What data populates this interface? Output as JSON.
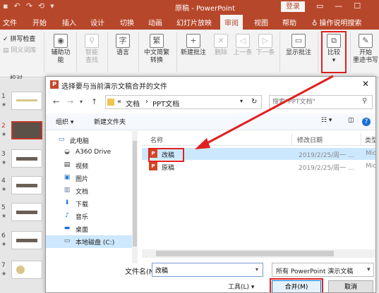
{
  "titlebar": {
    "quick_access": [
      "↶",
      "↷",
      "⟲",
      "▾"
    ],
    "doc_name": "原稿",
    "separator": "-",
    "app_name": "PowerPoint",
    "login": "登录",
    "controls": [
      "▭",
      "—",
      "☐"
    ]
  },
  "tabs": [
    "文件",
    "开始",
    "插入",
    "设计",
    "切换",
    "动画",
    "幻灯片放映",
    "审阅",
    "视图",
    "帮助",
    "操作说明搜索"
  ],
  "active_tab": "审阅",
  "ribbon": {
    "spelling": "拼写检查",
    "thesaurus": "同义词库",
    "proofing_group": "校对",
    "accessibility": [
      "辅助功",
      "能"
    ],
    "smart_lookup": [
      "智能",
      "查找"
    ],
    "language": "语言",
    "chinese_conversion": [
      "中文简繁",
      "转换"
    ],
    "new_comment": "新建批注",
    "delete": "删除",
    "previous": "上一条",
    "next": "下一条",
    "show_comments": "显示批注",
    "compare": "比较",
    "ink": [
      "开始",
      "墨迹书写"
    ]
  },
  "slides": [
    {
      "num": "1",
      "star": "★"
    },
    {
      "num": "2",
      "star": "★"
    },
    {
      "num": "3",
      "star": "★"
    },
    {
      "num": "4",
      "star": "★"
    },
    {
      "num": "5",
      "star": "★"
    },
    {
      "num": "6",
      "star": "★"
    },
    {
      "num": "7",
      "star": "★"
    }
  ],
  "dialog": {
    "title": "选择要与当前演示文稿合并的文件",
    "close": "✕",
    "nav": {
      "back": "←",
      "forward": "→",
      "dropdown": "▾",
      "up": "↑"
    },
    "address": {
      "prefix": "«",
      "folder1": "文档",
      "sep": "›",
      "folder2": "PPT文档",
      "dropdown": "▾",
      "refresh": "↻"
    },
    "search_placeholder": "搜索\"PPT文档\"",
    "toolbar": {
      "organize": "组织 ▾",
      "new_folder": "新建文件夹",
      "view": "☷ ▾",
      "pane": "◫",
      "help": "?"
    },
    "tree": [
      {
        "icon": "▭",
        "label": "此电脑"
      },
      {
        "icon": "◒",
        "label": "A360 Drive"
      },
      {
        "icon": "▤",
        "label": "视频"
      },
      {
        "icon": "▣",
        "label": "图片"
      },
      {
        "icon": "▥",
        "label": "文档"
      },
      {
        "icon": "⬇",
        "label": "下载"
      },
      {
        "icon": "♪",
        "label": "音乐"
      },
      {
        "icon": "▬",
        "label": "桌面"
      },
      {
        "icon": "▭",
        "label": "本地磁盘 (C:)"
      }
    ],
    "columns": {
      "name": "名称",
      "date": "修改日期",
      "type": "类型"
    },
    "files": [
      {
        "name": "改稿",
        "date": "2019/2/25/周一 ...",
        "type": "Micr"
      },
      {
        "name": "原稿",
        "date": "2019/2/25/周一 ...",
        "type": "Micr"
      }
    ],
    "filename_label": "文件名(N):",
    "filename_value": "改稿",
    "filetype_value": "所有 PowerPoint 演示文稿",
    "tools": "工具(L) ▾",
    "merge": "合并(M)",
    "cancel": "取消"
  }
}
